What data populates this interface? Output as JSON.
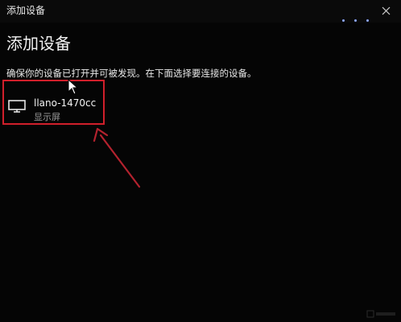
{
  "window": {
    "title": "添加设备",
    "close_icon": "close-icon"
  },
  "content": {
    "heading": "添加设备",
    "instruction": "确保你的设备已打开并可被发现。在下面选择要连接的设备。"
  },
  "devices": [
    {
      "name": "llano-1470cc",
      "type": "显示屏",
      "icon": "monitor-icon"
    }
  ],
  "colors": {
    "background": "#050505",
    "highlight_box": "#d11f2b",
    "arrow": "#b3222e",
    "loading_dots": "#8fa9ff",
    "secondary_text": "#9a9a9a"
  }
}
